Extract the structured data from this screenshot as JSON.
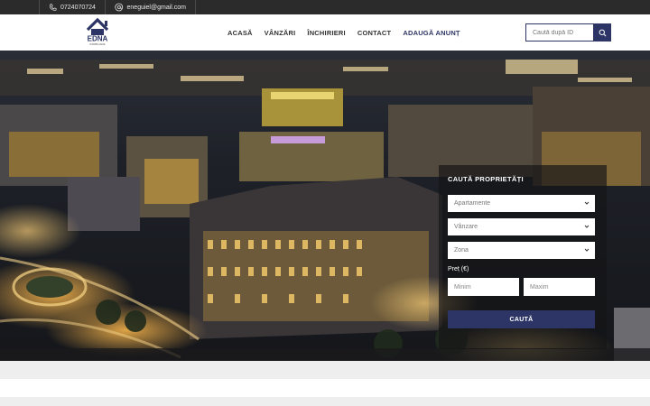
{
  "topbar": {
    "phone": "0724070724",
    "email": "eneguiel@gmail.com"
  },
  "logo": {
    "name": "EDNA",
    "tagline": "IMOBILIARE"
  },
  "nav": [
    {
      "label": "ACASĂ"
    },
    {
      "label": "VÂNZĂRI"
    },
    {
      "label": "ÎNCHIRIERI"
    },
    {
      "label": "CONTACT"
    },
    {
      "label": "ADAUGĂ ANUNȚ"
    }
  ],
  "search": {
    "placeholder": "Caută după ID"
  },
  "hero": {
    "image": "night city aerial photo"
  },
  "search_panel": {
    "title": "CAUTĂ PROPRIETĂȚI",
    "type_value": "Apartamente",
    "transaction_value": "Vânzare",
    "zone_value": "Zona",
    "price_label": "Preț (€)",
    "min_placeholder": "Minim",
    "max_placeholder": "Maxim",
    "submit_label": "CAUTĂ"
  },
  "colors": {
    "accent": "#2c3565",
    "topbar": "#2b2b2b"
  }
}
